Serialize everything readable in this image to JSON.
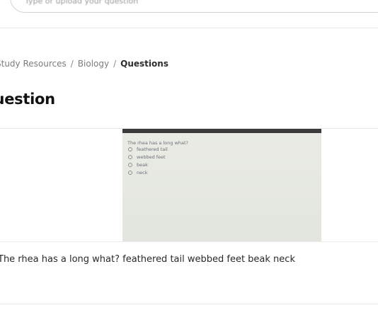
{
  "search": {
    "placeholder": "Type or upload your question"
  },
  "breadcrumb": {
    "items": [
      "Study Resources",
      "Biology"
    ],
    "current": "Questions"
  },
  "page": {
    "title": "Question"
  },
  "question": {
    "image": {
      "prompt": "The rhea has a long what?",
      "options": [
        "feathered tail",
        "webbed feet",
        "beak",
        "neck"
      ]
    },
    "text": "The rhea has a long what? feathered tail webbed feet beak neck"
  }
}
